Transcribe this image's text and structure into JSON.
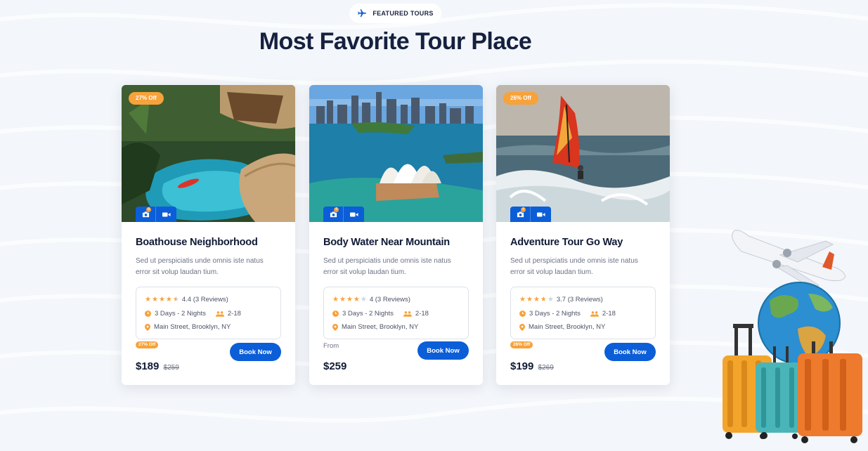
{
  "section": {
    "badge_label": "FEATURED TOURS",
    "title": "Most Favorite Tour Place"
  },
  "colors": {
    "accent_blue": "#0b5ed7",
    "accent_orange": "#f7a23a",
    "heading": "#15213f"
  },
  "cards": [
    {
      "discount_badge": "27% Off",
      "title": "Boathouse Neighborhood",
      "description": "Sed ut perspiciatis unde omnis iste natus error sit volup laudan tium.",
      "rating": 4.4,
      "rating_text": "4.4 (3 Reviews)",
      "duration": "3 Days - 2 Nights",
      "group_size": "2-18",
      "location": "Main Street, Brooklyn, NY",
      "price_tag": "27% Off",
      "price": "$189",
      "old_price": "$259",
      "button": "Book Now",
      "photo_count": "4"
    },
    {
      "discount_badge": "",
      "title": "Body Water Near Mountain",
      "description": "Sed ut perspiciatis unde omnis iste natus error sit volup laudan tium.",
      "rating": 4,
      "rating_text": "4 (3 Reviews)",
      "duration": "3 Days - 2 Nights",
      "group_size": "2-18",
      "location": "Main Street, Brooklyn, NY",
      "from_label": "From",
      "price": "$259",
      "button": "Book Now",
      "photo_count": "4"
    },
    {
      "discount_badge": "26% Off",
      "title": "Adventure Tour Go Way",
      "description": "Sed ut perspiciatis unde omnis iste natus error sit volup laudan tium.",
      "rating": 3.7,
      "rating_text": "3.7 (3 Reviews)",
      "duration": "3 Days - 2 Nights",
      "group_size": "2-18",
      "location": "Main Street, Brooklyn, NY",
      "price_tag": "26% Off",
      "price": "$199",
      "old_price": "$269",
      "button": "Book Now",
      "photo_count": "4"
    }
  ]
}
